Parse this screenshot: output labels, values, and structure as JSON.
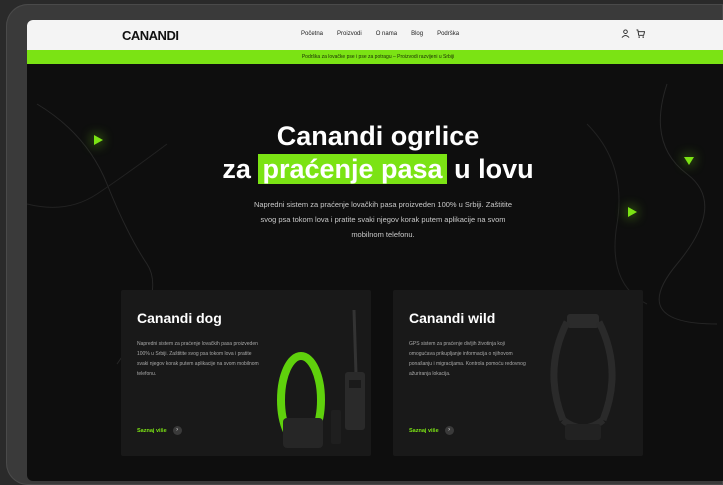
{
  "brand": "CANANDI",
  "nav": {
    "menu": [
      "Početna",
      "Proizvodi",
      "O nama",
      "Blog",
      "Podrška"
    ],
    "icons": [
      "user-icon",
      "cart-icon"
    ]
  },
  "promo_text": "Podrška za lovačke pse i pse za potragu – Proizvodi razvijeni u Srbiji",
  "hero": {
    "title_line1": "Canandi ogrlice",
    "title_pre": "za",
    "title_highlight": "praćenje pasa",
    "title_post": "u lovu",
    "subtitle": "Napredni sistem za praćenje lovačkih pasa proizveden 100% u Srbiji. Zaštitite svog psa tokom lova i pratite svaki njegov korak putem aplikacije na svom mobilnom telefonu."
  },
  "cards": [
    {
      "title": "Canandi dog",
      "desc": "Napredni sistem za praćenje lovačkih pasa proizveden 100% u Srbiji. Zaštitite svog psa tokom lova i pratite svaki njegov korak putem aplikacije na svom mobilnom telefonu.",
      "link": "Saznaj više",
      "arrow": "›"
    },
    {
      "title": "Canandi wild",
      "desc": "GPS sistem za praćenje divljih životinja koji omogućava prikupljanje informacija o njihovom ponašanju i migracijama. Kontrola pomoću redovnog ažuriranja lokacija.",
      "link": "Saznaj više",
      "arrow": "›"
    }
  ],
  "colors": {
    "accent": "#7be314",
    "background": "#0e0e0e",
    "card": "#191919"
  }
}
